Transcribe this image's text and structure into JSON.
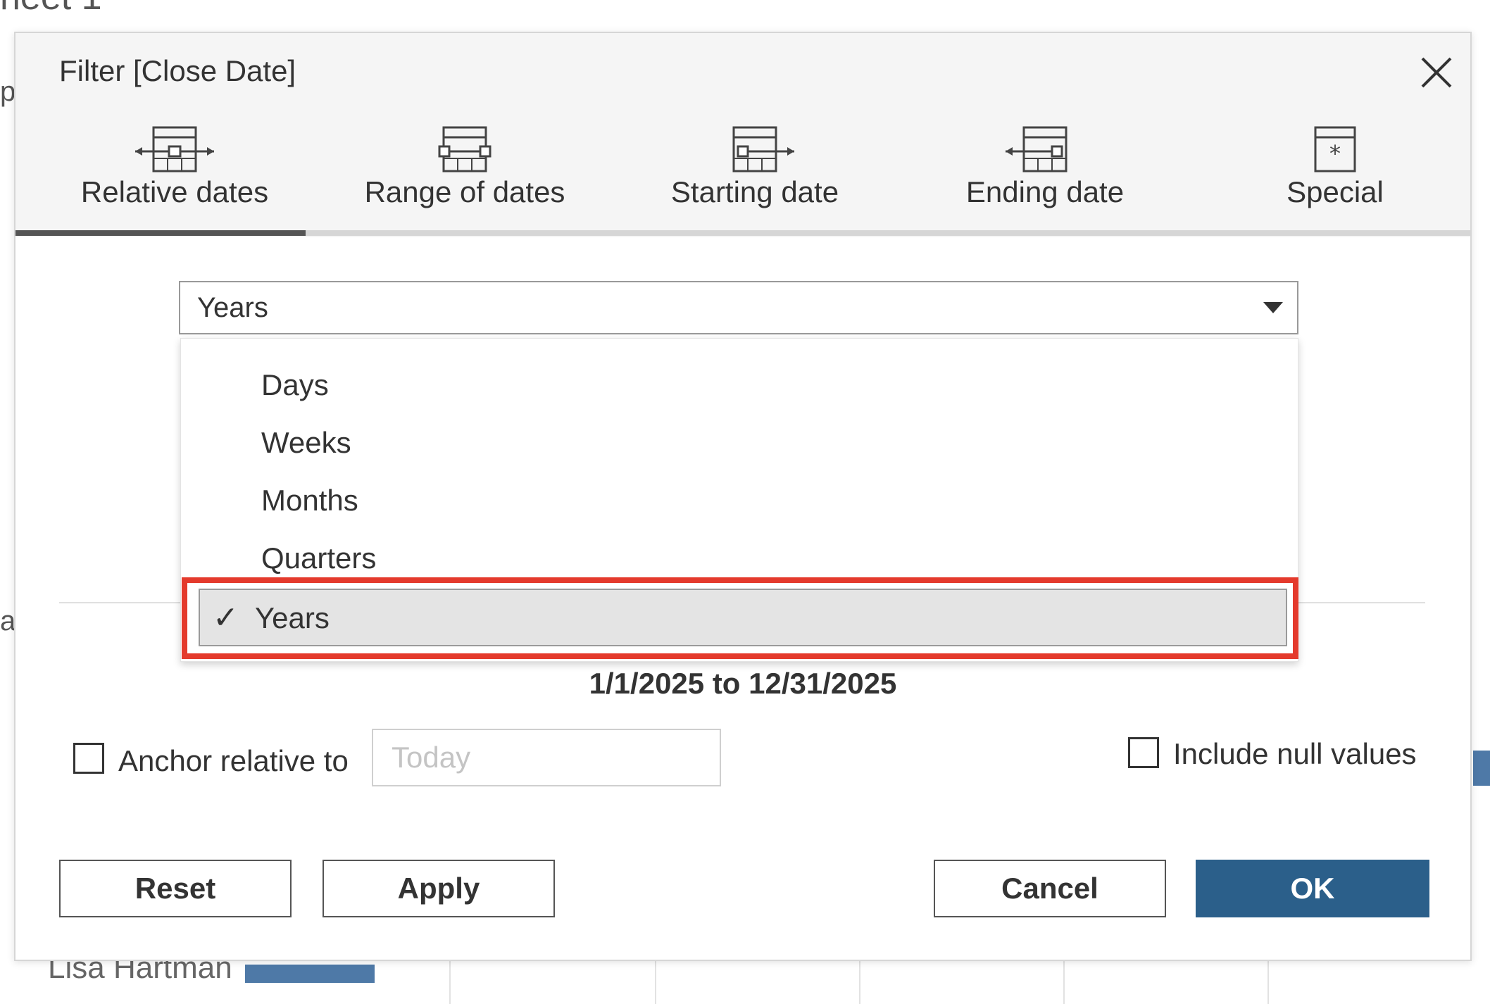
{
  "background": {
    "header_fragment": "heet 1",
    "left_fragment_top": "p",
    "left_fragment_mid": "a",
    "row_name": "Lisa Hartman"
  },
  "dialog": {
    "title": "Filter [Close Date]",
    "close_icon": "close-icon",
    "tabs": [
      {
        "label": "Relative dates",
        "icon": "relative-dates-icon",
        "active": true
      },
      {
        "label": "Range of dates",
        "icon": "range-of-dates-icon",
        "active": false
      },
      {
        "label": "Starting date",
        "icon": "starting-date-icon",
        "active": false
      },
      {
        "label": "Ending date",
        "icon": "ending-date-icon",
        "active": false
      },
      {
        "label": "Special",
        "icon": "special-icon",
        "active": false
      }
    ],
    "period_select": {
      "value": "Years",
      "options": [
        "Days",
        "Weeks",
        "Months",
        "Quarters",
        "Years"
      ],
      "selected_index": 4,
      "check_mark": "✓"
    },
    "date_range": "1/1/2025 to 12/31/2025",
    "anchor": {
      "label": "Anchor relative to",
      "placeholder": "Today",
      "checked": false
    },
    "include_null": {
      "label": "Include null values",
      "checked": false
    },
    "buttons": {
      "reset": "Reset",
      "apply": "Apply",
      "cancel": "Cancel",
      "ok": "OK"
    },
    "colors": {
      "ok_button": "#2b5f8a",
      "highlight": "#e43a2c",
      "active_tab": "#555555"
    }
  }
}
